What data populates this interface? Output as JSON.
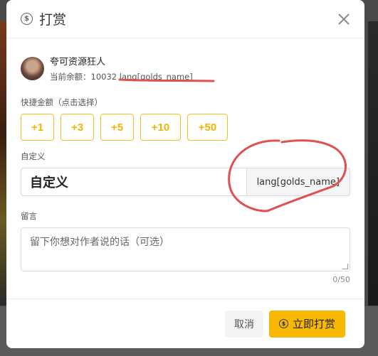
{
  "dialog": {
    "title": "打赏",
    "close_icon": "close-icon",
    "coin_icon": "coin-icon"
  },
  "user": {
    "name": "夸可资源狂人",
    "balance_label": "当前余额：",
    "balance_value": "10032",
    "currency_unit": "lang[golds_name]"
  },
  "quick_amount": {
    "label": "快捷金额（点击选择）",
    "options": [
      "+1",
      "+3",
      "+5",
      "+10",
      "+50"
    ]
  },
  "custom": {
    "label": "自定义",
    "input_value": "自定义",
    "unit": "lang[golds_name]"
  },
  "message": {
    "label": "留言",
    "placeholder": "留下你想对作者说的话（可选）",
    "counter": "0/50"
  },
  "footer": {
    "cancel_label": "取消",
    "confirm_label": "立即打赏"
  },
  "colors": {
    "accent": "#f6b800",
    "quick_border": "#f5c21b",
    "annotation": "#e05050"
  }
}
